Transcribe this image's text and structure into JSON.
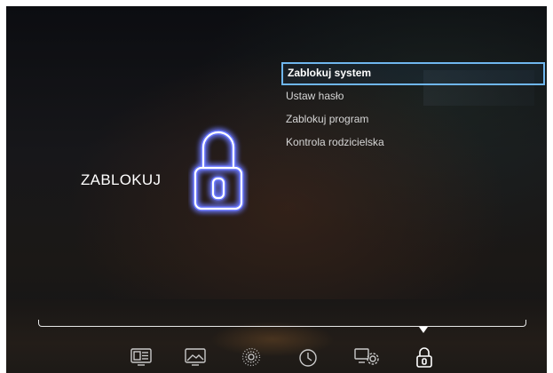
{
  "section": {
    "title": "ZABLOKUJ",
    "icon": "padlock-icon"
  },
  "menu": {
    "items": [
      {
        "label": "Zablokuj system",
        "selected": true
      },
      {
        "label": "Ustaw hasło",
        "selected": false
      },
      {
        "label": "Zablokuj program",
        "selected": false
      },
      {
        "label": "Kontrola rodzicielska",
        "selected": false
      }
    ]
  },
  "dock": {
    "icons": [
      "tv-info-icon",
      "picture-icon",
      "sound-icon",
      "clock-icon",
      "settings-icon",
      "lock-icon"
    ],
    "active": "lock-icon"
  },
  "colors": {
    "accent": "#6fb6ee",
    "lock_glow": "#3a4bff",
    "text": "#ffffff"
  }
}
